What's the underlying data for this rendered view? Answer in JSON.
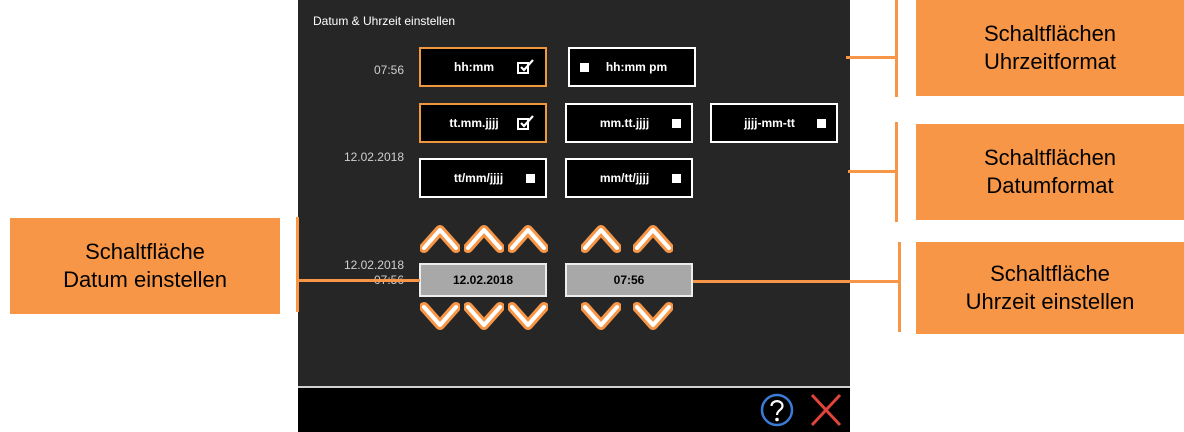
{
  "dialog": {
    "title": "Datum & Uhrzeit einstellen",
    "time_value": "07:56",
    "date_value": "12.02.2018",
    "current_date": "12.02.2018",
    "current_time": "07:56"
  },
  "time_formats": [
    {
      "label": "hh:mm",
      "selected": true
    },
    {
      "label": "hh:mm pm",
      "selected": false
    }
  ],
  "date_formats": [
    {
      "label": "tt.mm.jjjj",
      "selected": true
    },
    {
      "label": "mm.tt.jjjj",
      "selected": false
    },
    {
      "label": "jjjj-mm-tt",
      "selected": false
    },
    {
      "label": "tt/mm/jjjj",
      "selected": false
    },
    {
      "label": "mm/tt/jjjj",
      "selected": false
    }
  ],
  "set_buttons": {
    "date": "12.02.2018",
    "time": "07:56"
  },
  "footer": {
    "help_icon": "question-circle-icon",
    "close_icon": "close-x-icon"
  },
  "callouts": {
    "time_format_line1": "Schaltflächen",
    "time_format_line2": "Uhrzeitformat",
    "date_format_line1": "Schaltflächen",
    "date_format_line2": "Datumformat",
    "set_date_line1": "Schaltfläche",
    "set_date_line2": "Datum einstellen",
    "set_time_line1": "Schaltfläche",
    "set_time_line2": "Uhrzeit einstellen"
  },
  "colors": {
    "panel_bg": "#262626",
    "accent_orange": "#f79646",
    "selected_border": "#f0963c",
    "set_button_bg": "#a8a8a8"
  }
}
